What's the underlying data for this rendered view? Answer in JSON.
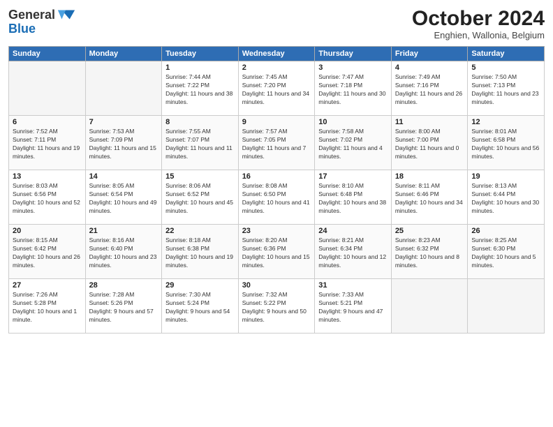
{
  "header": {
    "logo_general": "General",
    "logo_blue": "Blue",
    "month_title": "October 2024",
    "location": "Enghien, Wallonia, Belgium"
  },
  "weekdays": [
    "Sunday",
    "Monday",
    "Tuesday",
    "Wednesday",
    "Thursday",
    "Friday",
    "Saturday"
  ],
  "weeks": [
    [
      {
        "day": "",
        "sunrise": "",
        "sunset": "",
        "daylight": ""
      },
      {
        "day": "",
        "sunrise": "",
        "sunset": "",
        "daylight": ""
      },
      {
        "day": "1",
        "sunrise": "Sunrise: 7:44 AM",
        "sunset": "Sunset: 7:22 PM",
        "daylight": "Daylight: 11 hours and 38 minutes."
      },
      {
        "day": "2",
        "sunrise": "Sunrise: 7:45 AM",
        "sunset": "Sunset: 7:20 PM",
        "daylight": "Daylight: 11 hours and 34 minutes."
      },
      {
        "day": "3",
        "sunrise": "Sunrise: 7:47 AM",
        "sunset": "Sunset: 7:18 PM",
        "daylight": "Daylight: 11 hours and 30 minutes."
      },
      {
        "day": "4",
        "sunrise": "Sunrise: 7:49 AM",
        "sunset": "Sunset: 7:16 PM",
        "daylight": "Daylight: 11 hours and 26 minutes."
      },
      {
        "day": "5",
        "sunrise": "Sunrise: 7:50 AM",
        "sunset": "Sunset: 7:13 PM",
        "daylight": "Daylight: 11 hours and 23 minutes."
      }
    ],
    [
      {
        "day": "6",
        "sunrise": "Sunrise: 7:52 AM",
        "sunset": "Sunset: 7:11 PM",
        "daylight": "Daylight: 11 hours and 19 minutes."
      },
      {
        "day": "7",
        "sunrise": "Sunrise: 7:53 AM",
        "sunset": "Sunset: 7:09 PM",
        "daylight": "Daylight: 11 hours and 15 minutes."
      },
      {
        "day": "8",
        "sunrise": "Sunrise: 7:55 AM",
        "sunset": "Sunset: 7:07 PM",
        "daylight": "Daylight: 11 hours and 11 minutes."
      },
      {
        "day": "9",
        "sunrise": "Sunrise: 7:57 AM",
        "sunset": "Sunset: 7:05 PM",
        "daylight": "Daylight: 11 hours and 7 minutes."
      },
      {
        "day": "10",
        "sunrise": "Sunrise: 7:58 AM",
        "sunset": "Sunset: 7:02 PM",
        "daylight": "Daylight: 11 hours and 4 minutes."
      },
      {
        "day": "11",
        "sunrise": "Sunrise: 8:00 AM",
        "sunset": "Sunset: 7:00 PM",
        "daylight": "Daylight: 11 hours and 0 minutes."
      },
      {
        "day": "12",
        "sunrise": "Sunrise: 8:01 AM",
        "sunset": "Sunset: 6:58 PM",
        "daylight": "Daylight: 10 hours and 56 minutes."
      }
    ],
    [
      {
        "day": "13",
        "sunrise": "Sunrise: 8:03 AM",
        "sunset": "Sunset: 6:56 PM",
        "daylight": "Daylight: 10 hours and 52 minutes."
      },
      {
        "day": "14",
        "sunrise": "Sunrise: 8:05 AM",
        "sunset": "Sunset: 6:54 PM",
        "daylight": "Daylight: 10 hours and 49 minutes."
      },
      {
        "day": "15",
        "sunrise": "Sunrise: 8:06 AM",
        "sunset": "Sunset: 6:52 PM",
        "daylight": "Daylight: 10 hours and 45 minutes."
      },
      {
        "day": "16",
        "sunrise": "Sunrise: 8:08 AM",
        "sunset": "Sunset: 6:50 PM",
        "daylight": "Daylight: 10 hours and 41 minutes."
      },
      {
        "day": "17",
        "sunrise": "Sunrise: 8:10 AM",
        "sunset": "Sunset: 6:48 PM",
        "daylight": "Daylight: 10 hours and 38 minutes."
      },
      {
        "day": "18",
        "sunrise": "Sunrise: 8:11 AM",
        "sunset": "Sunset: 6:46 PM",
        "daylight": "Daylight: 10 hours and 34 minutes."
      },
      {
        "day": "19",
        "sunrise": "Sunrise: 8:13 AM",
        "sunset": "Sunset: 6:44 PM",
        "daylight": "Daylight: 10 hours and 30 minutes."
      }
    ],
    [
      {
        "day": "20",
        "sunrise": "Sunrise: 8:15 AM",
        "sunset": "Sunset: 6:42 PM",
        "daylight": "Daylight: 10 hours and 26 minutes."
      },
      {
        "day": "21",
        "sunrise": "Sunrise: 8:16 AM",
        "sunset": "Sunset: 6:40 PM",
        "daylight": "Daylight: 10 hours and 23 minutes."
      },
      {
        "day": "22",
        "sunrise": "Sunrise: 8:18 AM",
        "sunset": "Sunset: 6:38 PM",
        "daylight": "Daylight: 10 hours and 19 minutes."
      },
      {
        "day": "23",
        "sunrise": "Sunrise: 8:20 AM",
        "sunset": "Sunset: 6:36 PM",
        "daylight": "Daylight: 10 hours and 15 minutes."
      },
      {
        "day": "24",
        "sunrise": "Sunrise: 8:21 AM",
        "sunset": "Sunset: 6:34 PM",
        "daylight": "Daylight: 10 hours and 12 minutes."
      },
      {
        "day": "25",
        "sunrise": "Sunrise: 8:23 AM",
        "sunset": "Sunset: 6:32 PM",
        "daylight": "Daylight: 10 hours and 8 minutes."
      },
      {
        "day": "26",
        "sunrise": "Sunrise: 8:25 AM",
        "sunset": "Sunset: 6:30 PM",
        "daylight": "Daylight: 10 hours and 5 minutes."
      }
    ],
    [
      {
        "day": "27",
        "sunrise": "Sunrise: 7:26 AM",
        "sunset": "Sunset: 5:28 PM",
        "daylight": "Daylight: 10 hours and 1 minute."
      },
      {
        "day": "28",
        "sunrise": "Sunrise: 7:28 AM",
        "sunset": "Sunset: 5:26 PM",
        "daylight": "Daylight: 9 hours and 57 minutes."
      },
      {
        "day": "29",
        "sunrise": "Sunrise: 7:30 AM",
        "sunset": "Sunset: 5:24 PM",
        "daylight": "Daylight: 9 hours and 54 minutes."
      },
      {
        "day": "30",
        "sunrise": "Sunrise: 7:32 AM",
        "sunset": "Sunset: 5:22 PM",
        "daylight": "Daylight: 9 hours and 50 minutes."
      },
      {
        "day": "31",
        "sunrise": "Sunrise: 7:33 AM",
        "sunset": "Sunset: 5:21 PM",
        "daylight": "Daylight: 9 hours and 47 minutes."
      },
      {
        "day": "",
        "sunrise": "",
        "sunset": "",
        "daylight": ""
      },
      {
        "day": "",
        "sunrise": "",
        "sunset": "",
        "daylight": ""
      }
    ]
  ]
}
